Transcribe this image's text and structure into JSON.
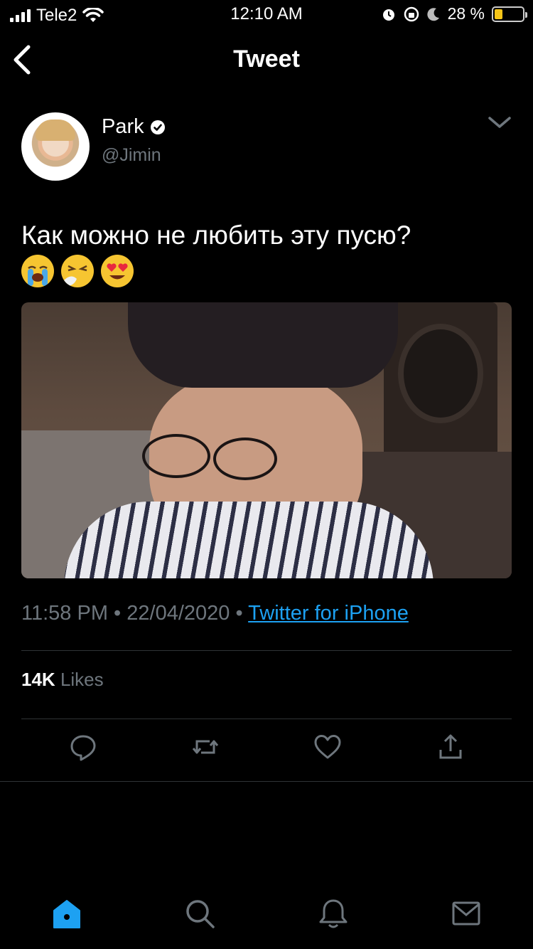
{
  "status_bar": {
    "carrier": "Tele2",
    "time": "12:10 AM",
    "battery_percent": "28 %",
    "battery_level": 0.28,
    "battery_color": "#f5c518"
  },
  "header": {
    "back_icon": "chevron-left-icon",
    "title": "Tweet"
  },
  "tweet": {
    "author_name": "Park",
    "author_handle": "@Jimin",
    "verified": true,
    "text": "Как можно не любить эту пусю?",
    "emojis": [
      "loudly-crying-face",
      "sneezing-face",
      "heart-eyes-face"
    ],
    "time": "11:58 PM",
    "date": "22/04/2020",
    "source": "Twitter for iPhone",
    "likes_count": "14K",
    "likes_label": "Likes"
  },
  "actions": [
    "reply-icon",
    "retweet-icon",
    "like-icon",
    "share-icon"
  ],
  "tabbar": [
    "home-icon",
    "search-icon",
    "notifications-icon",
    "messages-icon"
  ],
  "colors": {
    "background": "#000000",
    "accent": "#1da1f2",
    "secondary_text": "#6e767d",
    "divider": "#2f3336"
  }
}
